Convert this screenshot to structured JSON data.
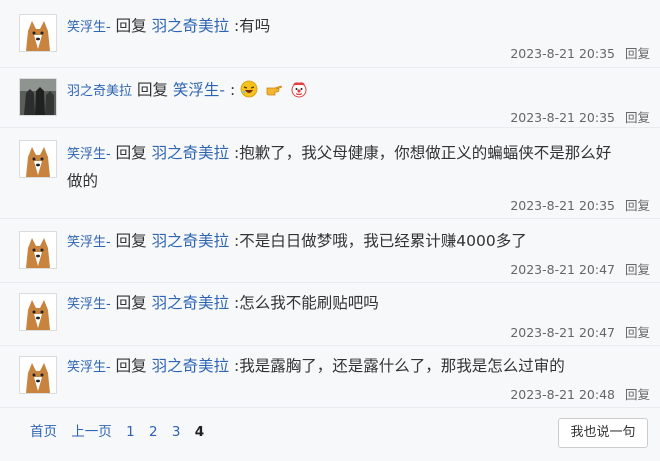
{
  "replies": [
    {
      "user": "笑浮生-",
      "reply_word": "回复",
      "target": "羽之奇美拉",
      "text": ":有吗",
      "text2": "",
      "time": "2023-8-21 20:35",
      "reply_label": "回复",
      "avatar": "corgi-dog"
    },
    {
      "user": "羽之奇美拉",
      "reply_word": "回复",
      "target": "笑浮生-",
      "text": ":",
      "text2": "",
      "time": "2023-8-21 20:35",
      "reply_label": "回复",
      "avatar": "dark-figures",
      "emojis": [
        "laughing-face-icon",
        "pointing-hand-icon",
        "clown-face-icon"
      ]
    },
    {
      "user": "笑浮生-",
      "reply_word": "回复",
      "target": "羽之奇美拉",
      "text": ":抱歉了，我父母健康，你想做正义的蝙蝠侠不是那么好",
      "text2": "做的",
      "time": "2023-8-21 20:35",
      "reply_label": "回复",
      "avatar": "corgi-dog"
    },
    {
      "user": "笑浮生-",
      "reply_word": "回复",
      "target": "羽之奇美拉",
      "text": ":不是白日做梦哦，我已经累计赚4000多了",
      "text2": "",
      "time": "2023-8-21 20:47",
      "reply_label": "回复",
      "avatar": "corgi-dog"
    },
    {
      "user": "笑浮生-",
      "reply_word": "回复",
      "target": "羽之奇美拉",
      "text": ":怎么我不能刷贴吧吗",
      "text2": "",
      "time": "2023-8-21 20:47",
      "reply_label": "回复",
      "avatar": "corgi-dog"
    },
    {
      "user": "笑浮生-",
      "reply_word": "回复",
      "target": "羽之奇美拉",
      "text": ":我是露胸了，还是露什么了，那我是怎么过审的",
      "text2": "",
      "time": "2023-8-21 20:48",
      "reply_label": "回复",
      "avatar": "corgi-dog"
    }
  ],
  "pager": {
    "first": "首页",
    "prev": "上一页",
    "p1": "1",
    "p2": "2",
    "p3": "3",
    "current": "4"
  },
  "say_button": "我也说一句",
  "colors": {
    "link": "#2d64b3",
    "text": "#333333",
    "background": "#f7f8fa"
  }
}
